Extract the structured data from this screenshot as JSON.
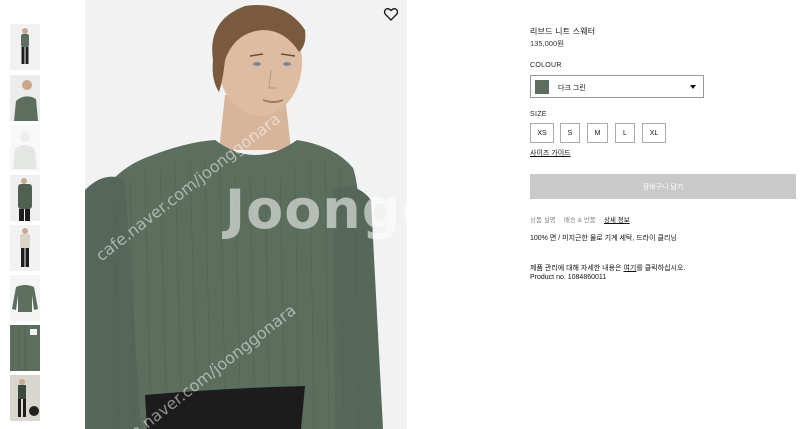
{
  "product": {
    "title": "리브드 니트 스웨터",
    "price": "135,000원",
    "colour_label": "COLOUR",
    "colour_name": "다크 그린",
    "colour_hex": "#5c6e5e",
    "size_label": "SIZE",
    "sizes": [
      "XS",
      "S",
      "M",
      "L",
      "XL"
    ],
    "size_guide": "사이즈 가이드",
    "add_to_bag": "장바구니 담기",
    "tabs": [
      "상품 설명",
      "배송 & 반품",
      "상세 정보"
    ],
    "material": "100% 면 / 미지근한 물로 기계 세탁, 드라이 클리닝",
    "care_prefix": "제품 관리에 대해 자세한 내용은 ",
    "care_link": "여기",
    "care_suffix": "를 클릭하십시오.",
    "product_number": "Product no. 1084860011"
  },
  "watermark": {
    "brand": "Joongg",
    "url_1": "m.naver.com/joonggonara",
    "url_2": "cafe.naver.com/joonggonara",
    "url_3": "ver.com/joong"
  },
  "colors": {
    "sweater": "#5c6e5e",
    "button_disabled": "#c9c9c9",
    "background": "#f2f2f2"
  }
}
